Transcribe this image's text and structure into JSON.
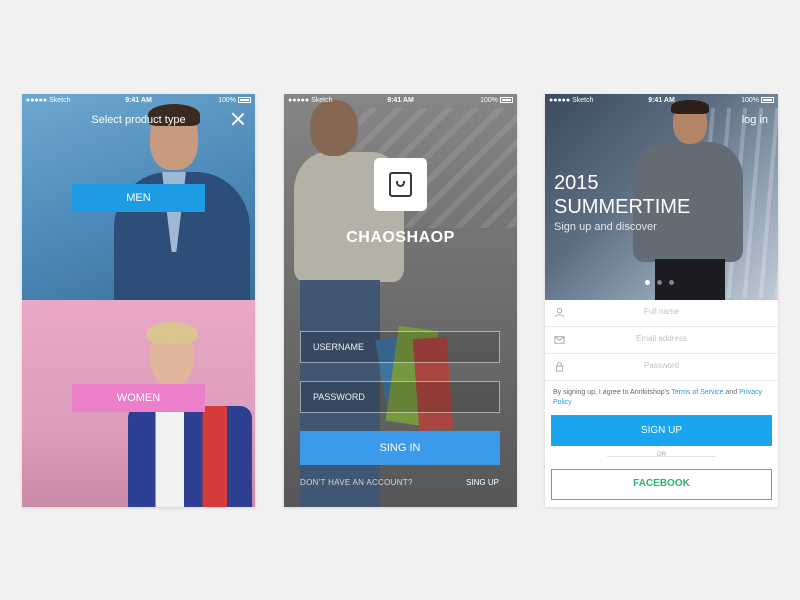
{
  "statusbar": {
    "carrier": "●●●●● Sketch",
    "time": "9:41 AM",
    "battery": "100%"
  },
  "screen1": {
    "title": "Select product type",
    "men_label": "MEN",
    "women_label": "WOMEN"
  },
  "screen2": {
    "brand": "CHAOSHAOP",
    "username_placeholder": "USERNAME",
    "password_placeholder": "PASSWORD",
    "signin_label": "SING IN",
    "no_account_text": "DON'T HAVE AN ACCOUNT?",
    "signup_link": "SING UP"
  },
  "screen3": {
    "login_link": "log in",
    "hero_year": "2015",
    "hero_headline": "SUMMERTIME",
    "hero_sub": "Sign up and discover",
    "fullname_placeholder": "Full name",
    "email_placeholder": "Email address",
    "password_placeholder": "Password",
    "terms_prefix": "By signing up, I agree to Anrikitshop's",
    "terms_link": "Terms of Service",
    "terms_and": "and",
    "privacy_link": "Privacy Policy",
    "signup_label": "SIGN UP",
    "or_label": "OR",
    "facebook_label": "FACEBOOK",
    "active_slide": 1,
    "slide_count": 3
  },
  "colors": {
    "accent_blue": "#1d9ce5",
    "women_pink": "#ec7fc9",
    "facebook_green": "#34c27a",
    "background": "#f1f1f1"
  }
}
